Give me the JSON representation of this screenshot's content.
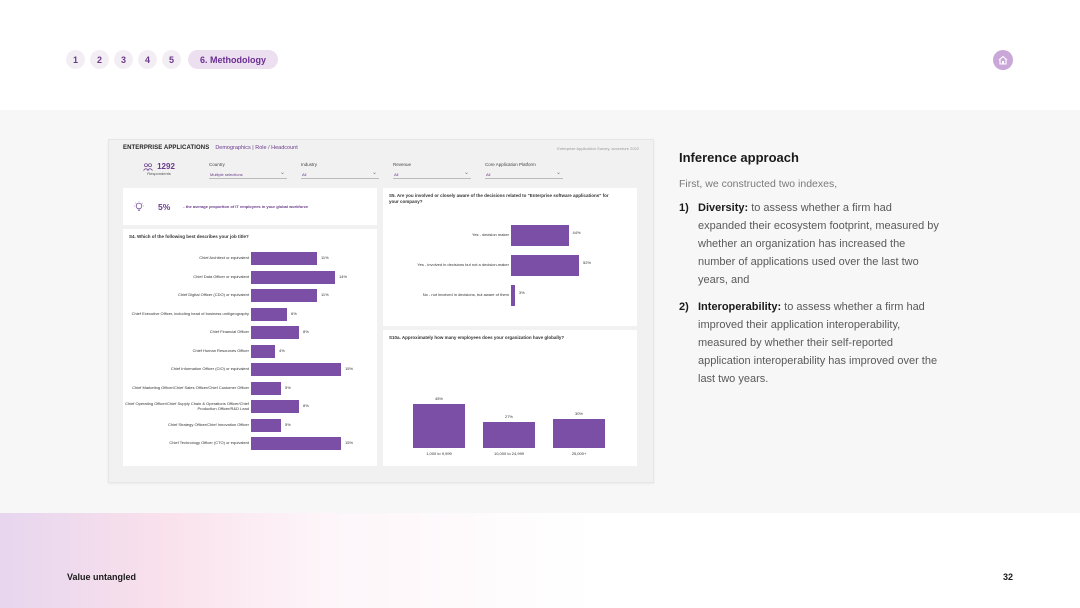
{
  "nav": {
    "items": [
      "1",
      "2",
      "3",
      "4",
      "5"
    ],
    "active": "6. Methodology"
  },
  "dashboard": {
    "title": "ENTERPRISE APPLICATIONS",
    "crumbs": "Demographics | Role / Headcount",
    "tag": "Enterprise Application Survey, accenture 2022",
    "respondents": {
      "count": "1292",
      "label": "Respondents"
    },
    "filters": [
      {
        "label": "Country",
        "value": "Multiple selections"
      },
      {
        "label": "Industry",
        "value": "All"
      },
      {
        "label": "Revenue",
        "value": "All"
      },
      {
        "label": "Core Application Platform",
        "value": "All"
      }
    ],
    "kpi": {
      "value": "5%",
      "text": "- the average proportion of IT employees in your global workforce"
    }
  },
  "chart_data": [
    {
      "type": "bar",
      "orientation": "horizontal",
      "title": "S4. Which of the following best describes your job title?",
      "categories": [
        "Chief Architect or equivalent",
        "Chief Data Officer or equivalent",
        "Chief Digital Officer (CDO) or equivalent",
        "Chief Executive Officer, including head of business unit/geography",
        "Chief Financial Officer",
        "Chief Human Resources Officer",
        "Chief Information Officer (CIO) or equivalent",
        "Chief Marketing Officer/Chief Sales Officer/Chief Customer Officer",
        "Chief Operating Officer/Chief Supply Chain & Operations Officer/Chief Production Officer/R&D Lead",
        "Chief Strategy Officer/Chief Innovation Officer",
        "Chief Technology Officer (CTO) or equivalent"
      ],
      "values": [
        11,
        14,
        11,
        6,
        8,
        4,
        15,
        5,
        8,
        5,
        15
      ],
      "labels": [
        "11%",
        "14%",
        "11%",
        "6%",
        "8%",
        "4%",
        "15%",
        "5%",
        "8%",
        "5%",
        "15%"
      ]
    },
    {
      "type": "bar",
      "orientation": "horizontal",
      "title": "S5. Are you involved or closely aware of the decisions related to \"Enterprise software applications\" for your company?",
      "categories": [
        "Yes - decision maker",
        "Yes - involved in decisions but not a decision-maker",
        "No - not involved in decisions, but aware of them"
      ],
      "values": [
        44,
        52,
        3
      ],
      "labels": [
        "44%",
        "52%",
        "3%"
      ]
    },
    {
      "type": "bar",
      "orientation": "vertical",
      "title": "S10a. Approximately how many employees does your organization have globally?",
      "categories": [
        "1,000 to 9,999",
        "10,000 to 24,999",
        "25,000+"
      ],
      "values": [
        45,
        27,
        30
      ],
      "labels": [
        "45%",
        "27%",
        "30%"
      ]
    }
  ],
  "right": {
    "heading": "Inference approach",
    "intro": "First, we constructed two indexes,",
    "items": [
      {
        "num": "1)",
        "term": "Diversity:",
        "text": " to assess whether a firm had expanded their ecosystem footprint, measured by whether an organization has increased the number of applications used over the last two years, and"
      },
      {
        "num": "2)",
        "term": "Interoperability:",
        "text": " to assess whether a firm had improved their application interoperability, measured by whether their self-reported application interoperability has improved over the last two years."
      }
    ]
  },
  "footer": {
    "left": "Value untangled",
    "page": "32"
  },
  "colors": {
    "accent": "#7b4fa6",
    "nav_text": "#6a3a8c"
  }
}
